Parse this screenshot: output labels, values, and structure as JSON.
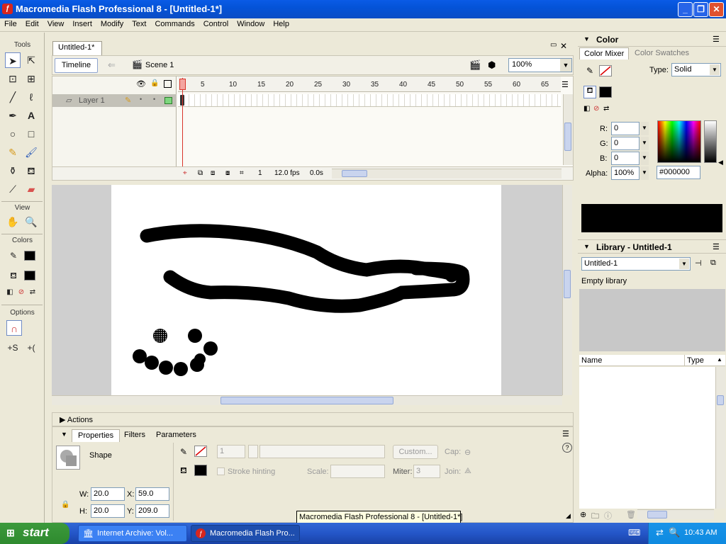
{
  "window": {
    "title": "Macromedia Flash Professional 8 - [Untitled-1*]"
  },
  "menu": [
    "File",
    "Edit",
    "View",
    "Insert",
    "Modify",
    "Text",
    "Commands",
    "Control",
    "Window",
    "Help"
  ],
  "tools": {
    "heading": "Tools",
    "view_heading": "View",
    "colors_heading": "Colors",
    "options_heading": "Options"
  },
  "document": {
    "tab_title": "Untitled-1*",
    "timeline_button": "Timeline",
    "scene": "Scene 1",
    "zoom": "100%"
  },
  "timeline": {
    "layer_name": "Layer 1",
    "ruler_ticks": [
      "1",
      "5",
      "10",
      "15",
      "20",
      "25",
      "30",
      "35",
      "40",
      "45",
      "50",
      "55",
      "60",
      "65"
    ],
    "current_frame": "1",
    "frame_rate": "12.0 fps",
    "elapsed_time": "0.0s"
  },
  "actions_panel": {
    "title": "Actions"
  },
  "properties": {
    "tabs": [
      "Properties",
      "Filters",
      "Parameters"
    ],
    "shape_label": "Shape",
    "stroke_height": "1",
    "custom_button": "Custom...",
    "cap_label": "Cap:",
    "stroke_hinting_label": "Stroke hinting",
    "scale_label": "Scale:",
    "miter_label": "Miter:",
    "miter_value": "3",
    "join_label": "Join:",
    "w_label": "W:",
    "w_value": "20.0",
    "h_label": "H:",
    "h_value": "20.0",
    "x_label": "X:",
    "x_value": "59.0",
    "y_label": "Y:",
    "y_value": "209.0"
  },
  "color_panel": {
    "title": "Color",
    "tabs": [
      "Color Mixer",
      "Color Swatches"
    ],
    "type_label": "Type:",
    "type_value": "Solid",
    "r_label": "R:",
    "r_value": "0",
    "g_label": "G:",
    "g_value": "0",
    "b_label": "B:",
    "b_value": "0",
    "alpha_label": "Alpha:",
    "alpha_value": "100%",
    "hex_value": "#000000",
    "preview_color": "#000000"
  },
  "library_panel": {
    "title": "Library - Untitled-1",
    "selected_document": "Untitled-1",
    "status": "Empty library",
    "col_name": "Name",
    "col_type": "Type"
  },
  "taskbar": {
    "start_label": "start",
    "task1": "Internet Archive: Vol...",
    "task2": "Macromedia Flash Pro...",
    "clock": "10:43 AM"
  },
  "tooltip": "Macromedia Flash Professional 8 - [Untitled-1*]"
}
